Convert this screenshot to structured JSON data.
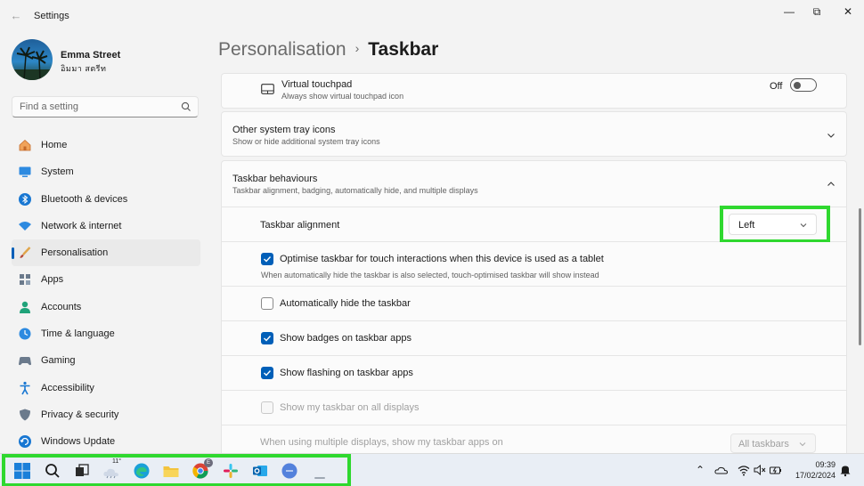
{
  "window": {
    "title": "Settings",
    "back_glyph": "←",
    "minimize_glyph": "—",
    "maximize_glyph": "⧉",
    "close_glyph": "✕"
  },
  "user": {
    "name": "Emma Street",
    "email": "อิมมา สตรีท"
  },
  "search": {
    "placeholder": "Find a setting",
    "icon": "search-icon"
  },
  "sidebar": {
    "items": [
      {
        "label": "Home",
        "icon": "home-icon"
      },
      {
        "label": "System",
        "icon": "system-icon"
      },
      {
        "label": "Bluetooth & devices",
        "icon": "bluetooth-icon"
      },
      {
        "label": "Network & internet",
        "icon": "wifi-icon"
      },
      {
        "label": "Personalisation",
        "icon": "brush-icon",
        "active": true
      },
      {
        "label": "Apps",
        "icon": "apps-icon"
      },
      {
        "label": "Accounts",
        "icon": "accounts-icon"
      },
      {
        "label": "Time & language",
        "icon": "clock-globe-icon"
      },
      {
        "label": "Gaming",
        "icon": "gamepad-icon"
      },
      {
        "label": "Accessibility",
        "icon": "accessibility-icon"
      },
      {
        "label": "Privacy & security",
        "icon": "shield-icon"
      },
      {
        "label": "Windows Update",
        "icon": "update-icon"
      }
    ]
  },
  "breadcrumb": {
    "parent": "Personalisation",
    "separator": "›",
    "current": "Taskbar"
  },
  "virtual_touchpad": {
    "title": "Virtual touchpad",
    "subtitle": "Always show virtual touchpad icon",
    "toggle_label": "Off",
    "toggle_on": false
  },
  "system_tray": {
    "title": "Other system tray icons",
    "subtitle": "Show or hide additional system tray icons"
  },
  "behaviours": {
    "title": "Taskbar behaviours",
    "subtitle": "Taskbar alignment, badging, automatically hide, and multiple displays",
    "alignment_label": "Taskbar alignment",
    "alignment_value": "Left",
    "options": [
      {
        "label": "Optimise taskbar for touch interactions when this device is used as a tablet",
        "checked": true,
        "sub": "When automatically hide the taskbar is also selected, touch-optimised taskbar will show instead"
      },
      {
        "label": "Automatically hide the taskbar",
        "checked": false
      },
      {
        "label": "Show badges on taskbar apps",
        "checked": true
      },
      {
        "label": "Show flashing on taskbar apps",
        "checked": true
      },
      {
        "label": "Show my taskbar on all displays",
        "checked": false,
        "disabled": true
      }
    ],
    "multi_display_label": "When using multiple displays, show my taskbar apps on",
    "multi_display_value": "All taskbars"
  },
  "taskbar": {
    "weather_temp": "11°",
    "chrome_badge": "E",
    "clock_time": "09:39",
    "clock_date": "17/02/2024"
  },
  "colors": {
    "accent": "#005fb8",
    "highlight": "#2fd82f"
  }
}
